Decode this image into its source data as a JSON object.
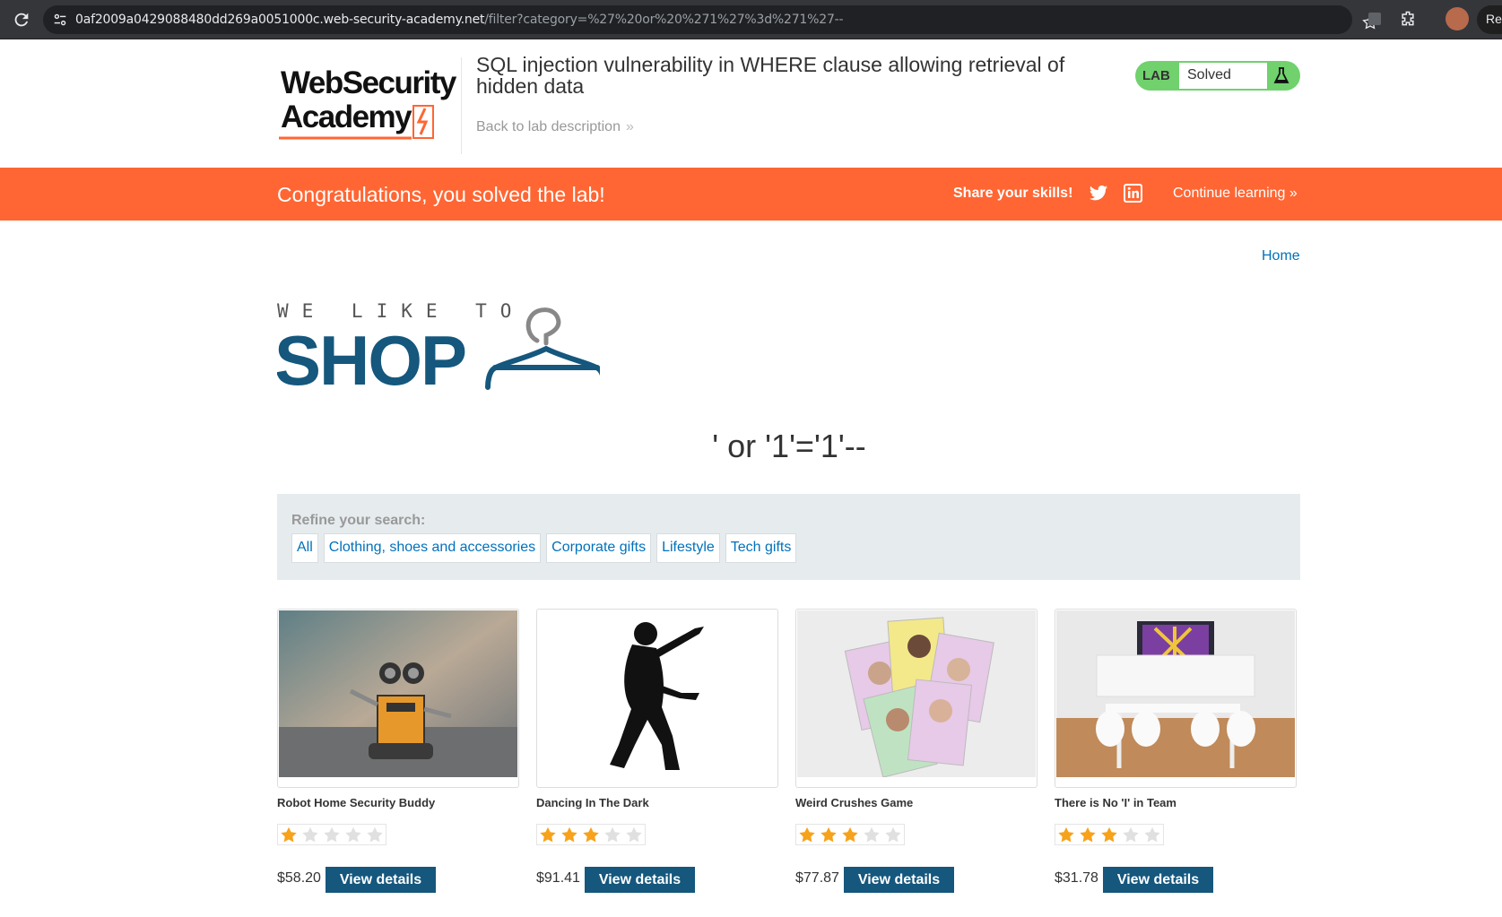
{
  "browser": {
    "url_host": "0af2009a0429088480dd269a0051000c.web-security-academy.net",
    "url_path": "/filter?category=%27%20or%20%271%27%3d%271%27--",
    "relaunch_label": "Re"
  },
  "academy": {
    "logo_line1": "WebSecurity",
    "logo_line2": "Academy",
    "lab_title": "SQL injection vulnerability in WHERE clause allowing retrieval of hidden data",
    "back_link": "Back to lab description",
    "lab_badge": "LAB",
    "lab_status": "Solved",
    "status_color": "#70d16d"
  },
  "banner": {
    "message": "Congratulations, you solved the lab!",
    "share_label": "Share your skills!",
    "continue_label": "Continue learning",
    "color": "#ff6633"
  },
  "shop": {
    "home_link": "Home",
    "logo_top": "WE LIKE TO",
    "logo_main": "SHOP",
    "search_term": "' or '1'='1'--",
    "refine_label": "Refine your search:",
    "filters": [
      "All",
      "Clothing, shoes and accessories",
      "Corporate gifts",
      "Lifestyle",
      "Tech gifts"
    ],
    "products": [
      {
        "name": "Robot Home Security Buddy",
        "rating": 1,
        "price": "$58.20",
        "button": "View details",
        "image": "robot-toy-image"
      },
      {
        "name": "Dancing In The Dark",
        "rating": 3,
        "price": "$91.41",
        "button": "View details",
        "image": "dancer-silhouette-image"
      },
      {
        "name": "Weird Crushes Game",
        "rating": 3,
        "price": "$77.87",
        "button": "View details",
        "image": "card-game-image"
      },
      {
        "name": "There is No 'I' in Team",
        "rating": 3,
        "price": "$31.78",
        "button": "View details",
        "image": "team-office-image"
      }
    ],
    "accent": "#15577d",
    "link_color": "#0071bc"
  }
}
